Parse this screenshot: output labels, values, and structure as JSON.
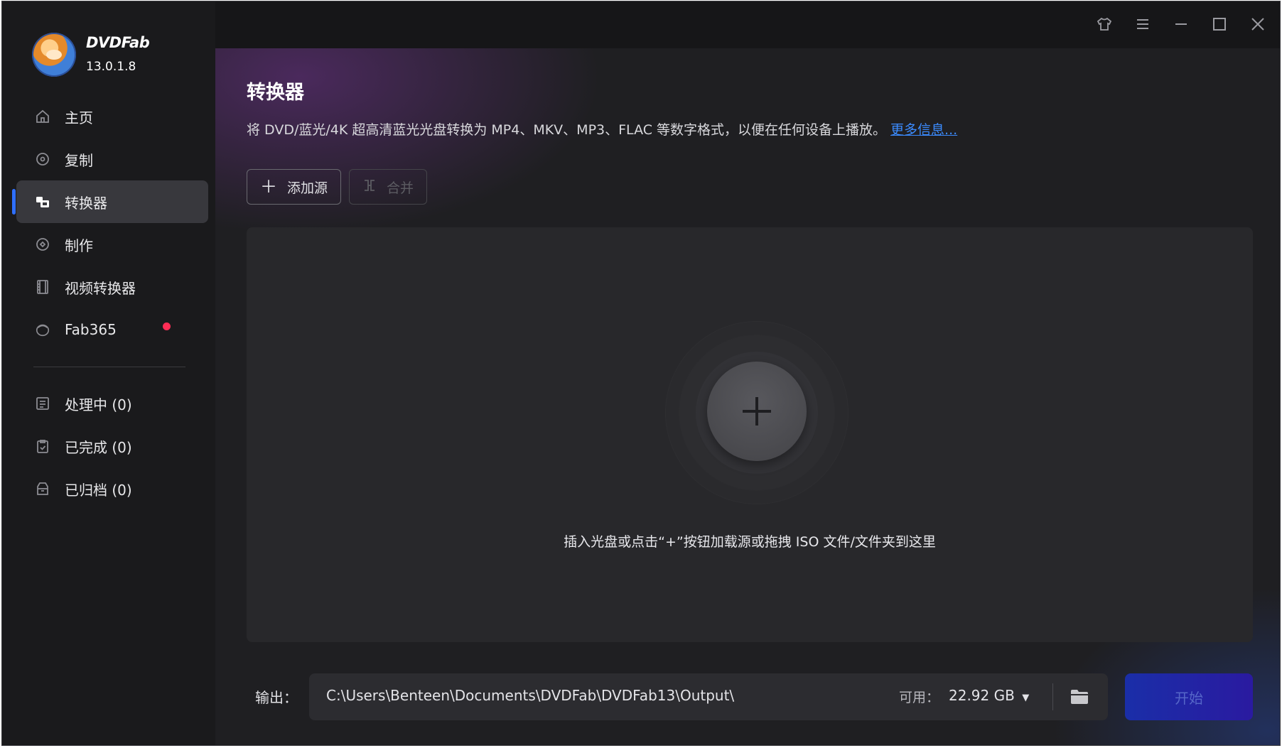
{
  "app": {
    "brand_name": "DVDFab",
    "version": "13.0.1.8"
  },
  "sidebar": {
    "items": [
      {
        "label": "主页",
        "icon": "home-icon"
      },
      {
        "label": "复制",
        "icon": "copy-disc-icon"
      },
      {
        "label": "转换器",
        "icon": "converter-icon",
        "active": true
      },
      {
        "label": "制作",
        "icon": "creator-disc-icon"
      },
      {
        "label": "视频转换器",
        "icon": "film-icon"
      },
      {
        "label": "Fab365",
        "icon": "fab365-icon",
        "badge": "red-dot"
      }
    ],
    "queue": [
      {
        "label": "处理中 (0)",
        "icon": "processing-icon"
      },
      {
        "label": "已完成 (0)",
        "icon": "completed-icon"
      },
      {
        "label": "已归档 (0)",
        "icon": "archived-icon"
      }
    ]
  },
  "titlebar": {
    "buttons": [
      "shirt-skin-icon",
      "menu-icon",
      "minimize-icon",
      "maximize-icon",
      "close-icon"
    ]
  },
  "main": {
    "title": "转换器",
    "description": "将 DVD/蓝光/4K 超高清蓝光光盘转换为 MP4、MKV、MP3、FLAC 等数字格式，以便在任何设备上播放。",
    "more_info": "更多信息...",
    "add_source_label": "添加源",
    "merge_label": "合并",
    "drop_hint": "插入光盘或点击“+”按钮加载源或拖拽 ISO 文件/文件夹到这里"
  },
  "output": {
    "label": "输出：",
    "path": "C:\\Users\\Benteen\\Documents\\DVDFab\\DVDFab13\\Output\\",
    "available_label": "可用：",
    "available_size": "22.92 GB",
    "start_label": "开始"
  },
  "colors": {
    "accent": "#2f6fff",
    "badge": "#ff2d55",
    "link": "#3b8bff"
  }
}
